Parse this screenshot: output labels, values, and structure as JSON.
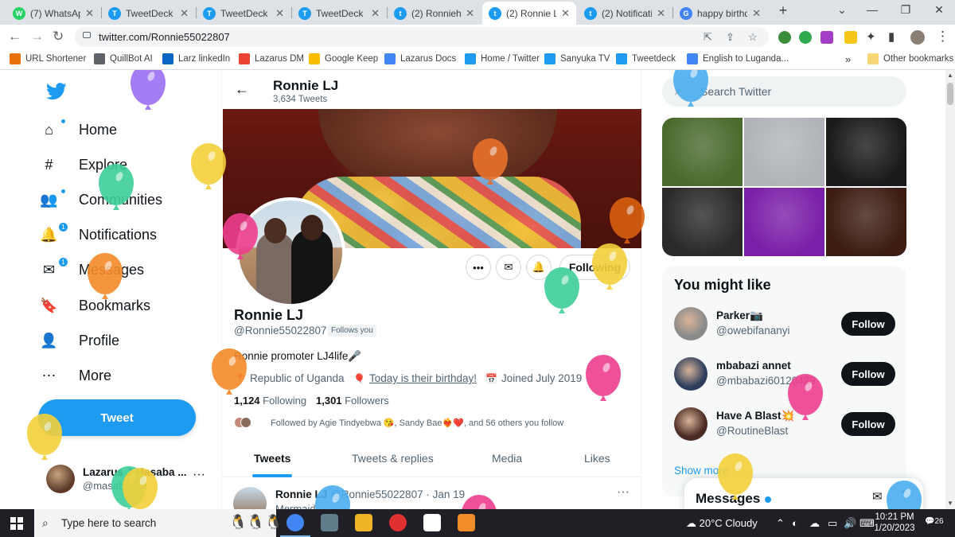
{
  "browser": {
    "tabs": [
      {
        "title": "(7) WhatsApp",
        "color": "#25d366",
        "glyph": "W"
      },
      {
        "title": "TweetDeck",
        "color": "#1d9bf0",
        "glyph": "T"
      },
      {
        "title": "TweetDeck",
        "color": "#1d9bf0",
        "glyph": "T"
      },
      {
        "title": "TweetDeck",
        "color": "#1d9bf0",
        "glyph": "T"
      },
      {
        "title": "(2) Ronniehc",
        "color": "#1d9bf0",
        "glyph": "t"
      },
      {
        "title": "(2) Ronnie LJ",
        "color": "#1d9bf0",
        "glyph": "t"
      },
      {
        "title": "(2) Notificatio",
        "color": "#1d9bf0",
        "glyph": "t"
      },
      {
        "title": "happy birthd",
        "color": "#4285f4",
        "glyph": "G"
      }
    ],
    "active_tab": 5,
    "new_tab": "+",
    "url": "twitter.com/Ronnie55022807",
    "bookmarks": [
      {
        "label": "URL Shortener",
        "color": "#e8710a"
      },
      {
        "label": "QuillBot AI",
        "color": "#5f6368"
      },
      {
        "label": "Larz linkedIn",
        "color": "#0a66c2"
      },
      {
        "label": "Lazarus DM",
        "color": "#ea4335"
      },
      {
        "label": "Google Keep",
        "color": "#fbbc04"
      },
      {
        "label": "Lazarus Docs",
        "color": "#4285f4"
      },
      {
        "label": "Home / Twitter",
        "color": "#1d9bf0"
      },
      {
        "label": "Sanyuka TV",
        "color": "#1d9bf0"
      },
      {
        "label": "Tweetdeck",
        "color": "#1d9bf0"
      },
      {
        "label": "English to Luganda...",
        "color": "#4285f4"
      }
    ],
    "bookmarks_overflow": "»",
    "other_bookmarks": "Other bookmarks"
  },
  "sidebar": {
    "nav": [
      {
        "label": "Home",
        "icon": "home-icon",
        "glyph": "⌂"
      },
      {
        "label": "Explore",
        "icon": "hashtag-icon",
        "glyph": "#"
      },
      {
        "label": "Communities",
        "icon": "communities-icon",
        "glyph": "👥"
      },
      {
        "label": "Notifications",
        "icon": "bell-icon",
        "glyph": "🔔",
        "badge": "1"
      },
      {
        "label": "Messages",
        "icon": "mail-icon",
        "glyph": "✉",
        "badge": "1"
      },
      {
        "label": "Bookmarks",
        "icon": "bookmark-icon",
        "glyph": "🔖"
      },
      {
        "label": "Profile",
        "icon": "person-icon",
        "glyph": "👤"
      },
      {
        "label": "More",
        "icon": "more-circle-icon",
        "glyph": "⋯"
      }
    ],
    "tweet_button": "Tweet",
    "account": {
      "name": "Lazarus J Masaba ...",
      "handle": "@masabala",
      "more": "···"
    }
  },
  "profile": {
    "header_name": "Ronnie LJ",
    "tweet_count": "3,634 Tweets",
    "name": "Ronnie LJ",
    "handle": "@Ronnie55022807",
    "follows_you": "Follows you",
    "bio": "Ronnie promoter LJ4life🎤",
    "location": "Republic of Uganda",
    "birthday": "Today is their birthday!",
    "joined": "Joined July 2019",
    "following_count": "1,124",
    "following_label": "Following",
    "followers_count": "1,301",
    "followers_label": "Followers",
    "followed_by": "Followed by Agie Tindyebwa 😘, Sandy Bae❤️‍🔥❤️, and 56 others you follow",
    "following_button": "Following",
    "tabs": [
      "Tweets",
      "Tweets & replies",
      "Media",
      "Likes"
    ],
    "active_tab": 0,
    "tweet": {
      "name": "Ronnie LJ",
      "handle": "@Ronnie55022807",
      "date": "· Jan 19",
      "text": "Mermaid"
    }
  },
  "right": {
    "search_placeholder": "Search Twitter",
    "media_colors": [
      "#4a6b2e",
      "#b0b4b8",
      "#1a1a1a",
      "#2a2a2a",
      "#7a1fa8",
      "#3d1d12"
    ],
    "wtf_title": "You might like",
    "suggestions": [
      {
        "name": "Parker📷",
        "handle": "@owebifananyi",
        "button": "Follow",
        "avatar": "#8a8a8a"
      },
      {
        "name": "mbabazi annet",
        "handle": "@mbabazi60120429",
        "button": "Follow",
        "avatar": "#2c3e5c"
      },
      {
        "name": "Have A Blast💥",
        "handle": "@RoutineBlast",
        "button": "Follow",
        "avatar": "#4a2a22"
      }
    ],
    "show_more": "Show more",
    "messages_title": "Messages"
  },
  "taskbar": {
    "search_text": "Type here to search",
    "weather": "20°C  Cloudy",
    "time": "10:21 PM",
    "date": "1/20/2023",
    "notifications": "26",
    "apps": [
      "#4285f4",
      "#607d8b",
      "#f0b429",
      "#e03030",
      "#ffffff",
      "#f28c28"
    ]
  },
  "balloons": [
    {
      "color": "#9b6ef3"
    },
    {
      "color": "#f3d03a"
    },
    {
      "color": "#3ecf9a"
    },
    {
      "color": "#f58a2a"
    },
    {
      "color": "#e8712a"
    },
    {
      "color": "#d95f10"
    },
    {
      "color": "#ee3f8f"
    },
    {
      "color": "#f3d03a"
    },
    {
      "color": "#3ecf9a"
    },
    {
      "color": "#f58a2a"
    },
    {
      "color": "#ee3f8f"
    },
    {
      "color": "#ee3f8f"
    },
    {
      "color": "#f3d03a"
    },
    {
      "color": "#3ecf9a"
    },
    {
      "color": "#4aaef0"
    },
    {
      "color": "#4aaef0"
    },
    {
      "color": "#f3d03a"
    },
    {
      "color": "#4aaef0"
    },
    {
      "color": "#ee3f8f"
    },
    {
      "color": "#f3d03a"
    }
  ]
}
